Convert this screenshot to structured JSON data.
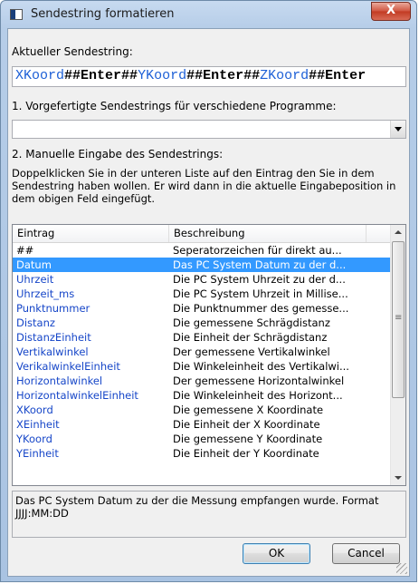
{
  "window": {
    "title": "Sendestring formatieren",
    "close_label": "X"
  },
  "current": {
    "label": "Aktueller Sendestring:",
    "tokens": [
      {
        "text": "XKoord",
        "kind": "tok"
      },
      {
        "text": "##",
        "kind": "sep"
      },
      {
        "text": "Enter",
        "kind": "ent"
      },
      {
        "text": "##",
        "kind": "sep"
      },
      {
        "text": "YKoord",
        "kind": "tok"
      },
      {
        "text": "##",
        "kind": "sep"
      },
      {
        "text": "Enter",
        "kind": "ent"
      },
      {
        "text": "##",
        "kind": "sep"
      },
      {
        "text": "ZKoord",
        "kind": "tok"
      },
      {
        "text": "##",
        "kind": "sep"
      },
      {
        "text": "Enter",
        "kind": "ent"
      }
    ]
  },
  "section1": {
    "label": "1. Vorgefertigte Sendestrings für verschiedene Programme:",
    "combo_value": ""
  },
  "section2": {
    "label": "2. Manuelle Eingabe des Sendestrings:",
    "description": "Doppelklicken Sie in der unteren Liste auf den Eintrag den Sie in dem Sendestring haben wollen. Er wird dann in die aktuelle Eingabeposition in dem obigen Feld eingefügt."
  },
  "list": {
    "columns": [
      "Eintrag",
      "Beschreibung"
    ],
    "selected_index": 1,
    "rows": [
      [
        "##",
        "Seperatorzeichen für direkt au..."
      ],
      [
        "Datum",
        "Das PC System Datum zu der d..."
      ],
      [
        "Uhrzeit",
        "Die PC System Uhrzeit zu der d..."
      ],
      [
        "Uhrzeit_ms",
        "Die PC System Uhrzeit in Millise..."
      ],
      [
        "Punktnummer",
        "Die Punktnummer des gemesse..."
      ],
      [
        "Distanz",
        "Die gemessene Schrägdistanz"
      ],
      [
        "DistanzEinheit",
        "Die Einheit der Schrägdistanz"
      ],
      [
        "Vertikalwinkel",
        "Der gemessene Vertikalwinkel"
      ],
      [
        "VerikalwinkelEinheit",
        "Die Winkeleinheit des Vertikalwi..."
      ],
      [
        "Horizontalwinkel",
        "Der gemessene Horizontalwinkel"
      ],
      [
        "HorizontalwinkelEinheit",
        "Die Winkeleinheit des Horizont..."
      ],
      [
        "XKoord",
        "Die gemessene X Koordinate"
      ],
      [
        "XEinheit",
        "Die Einheit der X Koordinate"
      ],
      [
        "YKoord",
        "Die gemessene Y Koordinate"
      ],
      [
        "YEinheit",
        "Die Einheit der Y Koordinate"
      ]
    ]
  },
  "info": {
    "text": "Das PC System Datum zu der die Messung empfangen wurde. Format JJJJ:MM:DD"
  },
  "buttons": {
    "ok": "OK",
    "cancel": "Cancel"
  }
}
